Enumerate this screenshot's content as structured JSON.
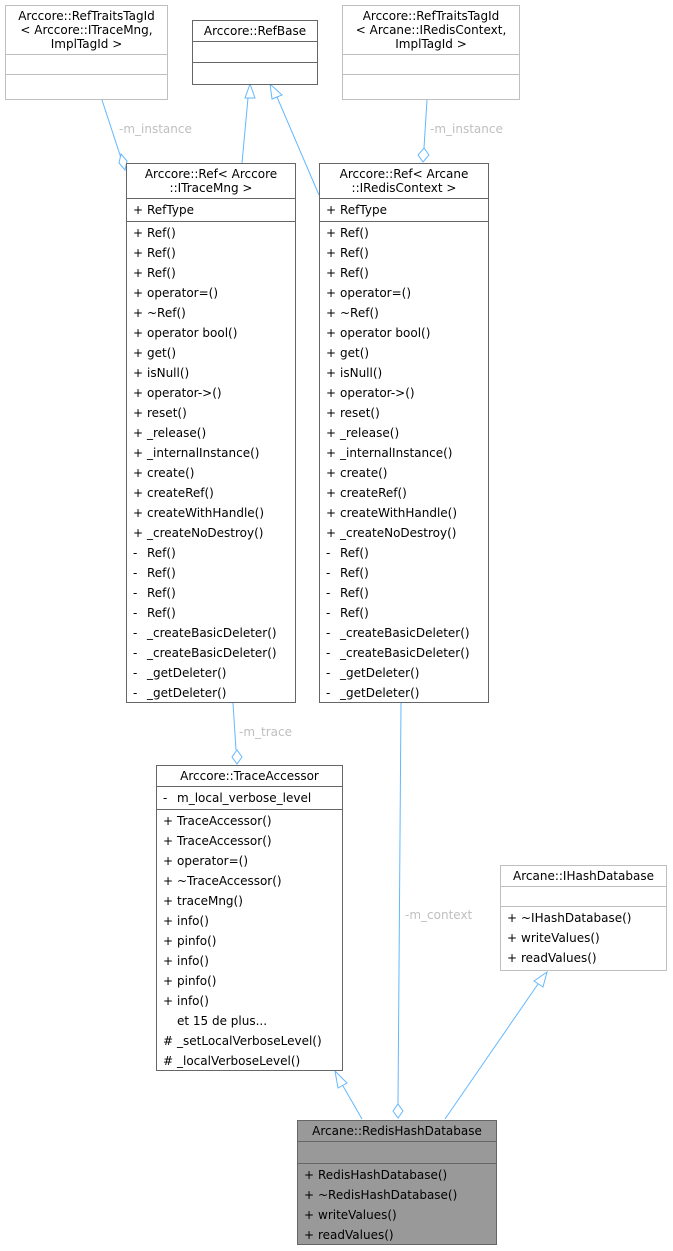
{
  "diagram": {
    "classes": {
      "reftraits_tracemng": {
        "title": "Arccore::RefTraitsTagId\n< Arccore::ITraceMng,\n ImplTagId >",
        "attributes": [],
        "methods": []
      },
      "refbase": {
        "title": "Arccore::RefBase",
        "attributes": [],
        "methods": []
      },
      "reftraits_rediscontext": {
        "title": "Arccore::RefTraitsTagId\n< Arcane::IRedisContext,\n ImplTagId >",
        "attributes": [],
        "methods": []
      },
      "ref_tracemng": {
        "title": "Arccore::Ref< Arccore\n::ITraceMng >",
        "attributes": [
          {
            "vis": "+",
            "name": "RefType"
          }
        ],
        "methods": [
          {
            "vis": "+",
            "name": "Ref()"
          },
          {
            "vis": "+",
            "name": "Ref()"
          },
          {
            "vis": "+",
            "name": "Ref()"
          },
          {
            "vis": "+",
            "name": "operator=()"
          },
          {
            "vis": "+",
            "name": "~Ref()"
          },
          {
            "vis": "+",
            "name": "operator bool()"
          },
          {
            "vis": "+",
            "name": "get()"
          },
          {
            "vis": "+",
            "name": "isNull()"
          },
          {
            "vis": "+",
            "name": "operator->()"
          },
          {
            "vis": "+",
            "name": "reset()"
          },
          {
            "vis": "+",
            "name": "_release()"
          },
          {
            "vis": "+",
            "name": "_internalInstance()"
          },
          {
            "vis": "+",
            "name": "create()"
          },
          {
            "vis": "+",
            "name": "createRef()"
          },
          {
            "vis": "+",
            "name": "createWithHandle()"
          },
          {
            "vis": "+",
            "name": "_createNoDestroy()"
          },
          {
            "vis": "-",
            "name": "Ref()"
          },
          {
            "vis": "-",
            "name": "Ref()"
          },
          {
            "vis": "-",
            "name": "Ref()"
          },
          {
            "vis": "-",
            "name": "Ref()"
          },
          {
            "vis": "-",
            "name": "_createBasicDeleter()"
          },
          {
            "vis": "-",
            "name": "_createBasicDeleter()"
          },
          {
            "vis": "-",
            "name": "_getDeleter()"
          },
          {
            "vis": "-",
            "name": "_getDeleter()"
          }
        ]
      },
      "ref_rediscontext": {
        "title": "Arccore::Ref< Arcane\n::IRedisContext >",
        "attributes": [
          {
            "vis": "+",
            "name": "RefType"
          }
        ],
        "methods": [
          {
            "vis": "+",
            "name": "Ref()"
          },
          {
            "vis": "+",
            "name": "Ref()"
          },
          {
            "vis": "+",
            "name": "Ref()"
          },
          {
            "vis": "+",
            "name": "operator=()"
          },
          {
            "vis": "+",
            "name": "~Ref()"
          },
          {
            "vis": "+",
            "name": "operator bool()"
          },
          {
            "vis": "+",
            "name": "get()"
          },
          {
            "vis": "+",
            "name": "isNull()"
          },
          {
            "vis": "+",
            "name": "operator->()"
          },
          {
            "vis": "+",
            "name": "reset()"
          },
          {
            "vis": "+",
            "name": "_release()"
          },
          {
            "vis": "+",
            "name": "_internalInstance()"
          },
          {
            "vis": "+",
            "name": "create()"
          },
          {
            "vis": "+",
            "name": "createRef()"
          },
          {
            "vis": "+",
            "name": "createWithHandle()"
          },
          {
            "vis": "+",
            "name": "_createNoDestroy()"
          },
          {
            "vis": "-",
            "name": "Ref()"
          },
          {
            "vis": "-",
            "name": "Ref()"
          },
          {
            "vis": "-",
            "name": "Ref()"
          },
          {
            "vis": "-",
            "name": "Ref()"
          },
          {
            "vis": "-",
            "name": "_createBasicDeleter()"
          },
          {
            "vis": "-",
            "name": "_createBasicDeleter()"
          },
          {
            "vis": "-",
            "name": "_getDeleter()"
          },
          {
            "vis": "-",
            "name": "_getDeleter()"
          }
        ]
      },
      "traceaccessor": {
        "title": "Arccore::TraceAccessor",
        "attributes": [
          {
            "vis": "-",
            "name": "m_local_verbose_level"
          }
        ],
        "methods": [
          {
            "vis": "+",
            "name": "TraceAccessor()"
          },
          {
            "vis": "+",
            "name": "TraceAccessor()"
          },
          {
            "vis": "+",
            "name": "operator=()"
          },
          {
            "vis": "+",
            "name": "~TraceAccessor()"
          },
          {
            "vis": "+",
            "name": "traceMng()"
          },
          {
            "vis": "+",
            "name": "info()"
          },
          {
            "vis": "+",
            "name": "pinfo()"
          },
          {
            "vis": "+",
            "name": "info()"
          },
          {
            "vis": "+",
            "name": "pinfo()"
          },
          {
            "vis": "+",
            "name": "info()"
          },
          {
            "vis": "",
            "name": "et 15 de plus..."
          },
          {
            "vis": "#",
            "name": "_setLocalVerboseLevel()"
          },
          {
            "vis": "#",
            "name": "_localVerboseLevel()"
          }
        ]
      },
      "ihashdatabase": {
        "title": "Arcane::IHashDatabase",
        "attributes": [],
        "methods": [
          {
            "vis": "+",
            "name": "~IHashDatabase()"
          },
          {
            "vis": "+",
            "name": "writeValues()"
          },
          {
            "vis": "+",
            "name": "readValues()"
          }
        ]
      },
      "redishashdatabase": {
        "title": "Arcane::RedisHashDatabase",
        "attributes": [],
        "methods": [
          {
            "vis": "+",
            "name": "RedisHashDatabase()"
          },
          {
            "vis": "+",
            "name": "~RedisHashDatabase()"
          },
          {
            "vis": "+",
            "name": "writeValues()"
          },
          {
            "vis": "+",
            "name": "readValues()"
          }
        ]
      }
    },
    "edge_labels": {
      "instance_left": "-m_instance",
      "instance_right": "-m_instance",
      "trace": "-m_trace",
      "context": "-m_context"
    },
    "colors": {
      "edge": "#63b8ff",
      "label": "#bfbfbf",
      "current_fill": "#999999",
      "box_border": "#666666",
      "light_border": "#bfbfbf"
    }
  }
}
